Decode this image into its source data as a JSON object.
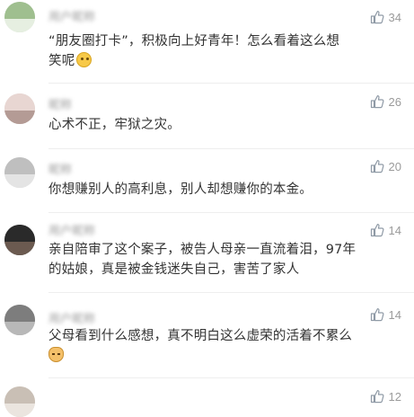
{
  "colors": {
    "text": "#333333",
    "muted": "#9a9a9a",
    "like_icon": "#8f9aa6",
    "divider": "#eeeeee"
  },
  "comments": [
    {
      "username": "用户昵称",
      "lines": [
        "“朋友圈打卡”，积极向上好青年！怎么看着这么想",
        "笑呢"
      ],
      "emoji": "thinking-face",
      "likes": "34"
    },
    {
      "username": "昵称",
      "lines": [
        "心术不正，牢狱之灾。"
      ],
      "likes": "26"
    },
    {
      "username": "昵称",
      "lines": [
        "你想赚别人的高利息，别人却想赚你的本金。"
      ],
      "likes": "20"
    },
    {
      "username": "用户昵称",
      "lines": [
        "亲自陪审了这个案子，被告人母亲一直流着泪，97年",
        "的姑娘，真是被金钱迷失自己，害苦了家人"
      ],
      "likes": "14"
    },
    {
      "username": "用户昵称",
      "lines": [
        "父母看到什么感想，真不明白这么虚荣的活着不累么"
      ],
      "emoji": "cat-face",
      "likes": "14"
    },
    {
      "username": "",
      "lines": [],
      "likes": "12"
    }
  ]
}
